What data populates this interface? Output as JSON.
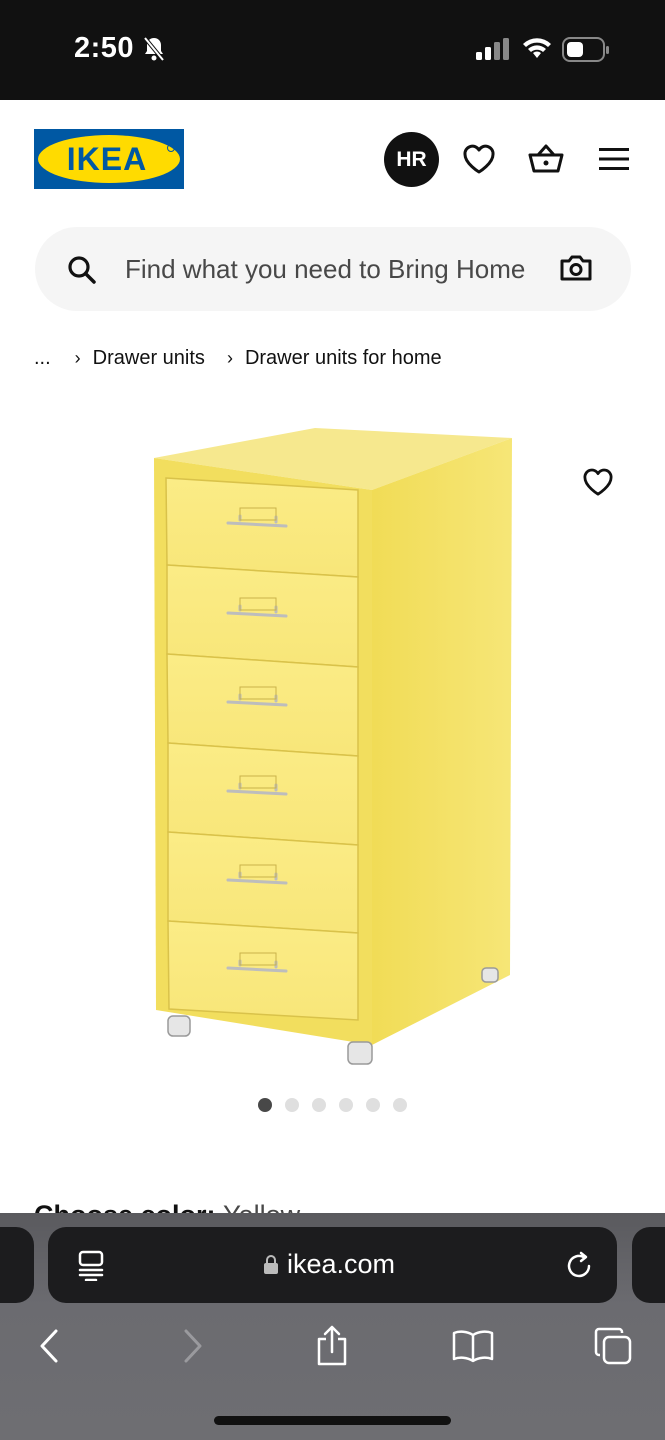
{
  "status_bar": {
    "time": "2:50"
  },
  "header": {
    "logo_text": "IKEA",
    "avatar_initials": "HR",
    "colors": {
      "brand_blue": "#0058A3",
      "brand_yellow": "#FFDB00"
    }
  },
  "search": {
    "placeholder": "Find what you need to Bring Home"
  },
  "breadcrumb": {
    "ellipsis": "...",
    "items": [
      "Drawer units",
      "Drawer units for home"
    ]
  },
  "product": {
    "image_count": 6,
    "active_image": 1,
    "color_label": "Choose color:",
    "color_value": "Yellow",
    "product_color": "#F7E46A"
  },
  "browser": {
    "url": "ikea.com"
  },
  "icons": {
    "bell": "bell-slash-icon",
    "heart": "heart-icon",
    "cart": "shopping-basket-icon",
    "menu": "hamburger-icon",
    "search": "search-icon",
    "camera": "camera-icon",
    "lock": "lock-icon",
    "reload": "reload-icon"
  }
}
